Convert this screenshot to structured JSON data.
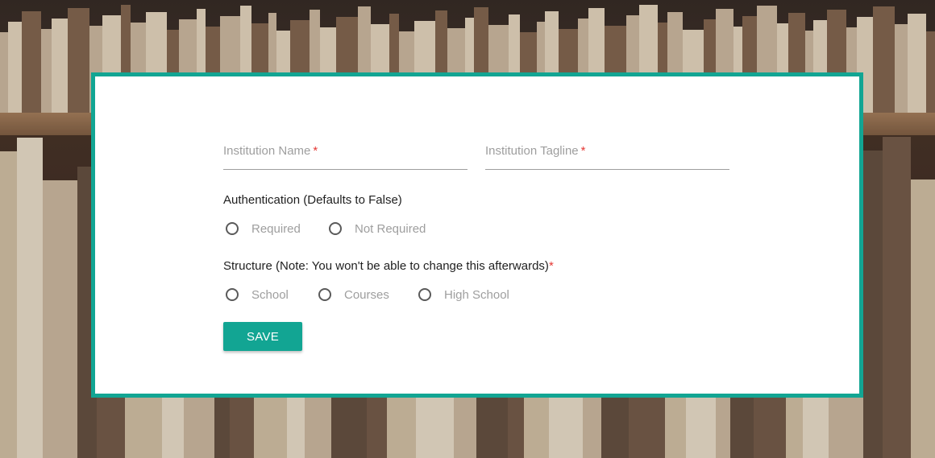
{
  "form": {
    "institution_name": {
      "label": "Institution Name",
      "required_marker": "*",
      "value": ""
    },
    "institution_tagline": {
      "label": "Institution Tagline",
      "required_marker": "*",
      "value": ""
    },
    "authentication": {
      "label": "Authentication (Defaults to False)",
      "options": [
        {
          "label": "Required",
          "selected": false
        },
        {
          "label": "Not Required",
          "selected": false
        }
      ]
    },
    "structure": {
      "label": "Structure (Note: You won't be able to change this afterwards)",
      "required_marker": "*",
      "options": [
        {
          "label": "School",
          "selected": false
        },
        {
          "label": "Courses",
          "selected": false
        },
        {
          "label": "High School",
          "selected": false
        }
      ]
    },
    "save_label": "SAVE"
  },
  "colors": {
    "accent": "#12a593",
    "required": "#e53935",
    "label_gray": "#9e9e9e",
    "text_dark": "#212121"
  }
}
